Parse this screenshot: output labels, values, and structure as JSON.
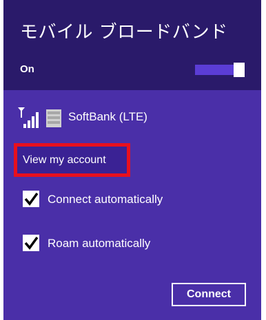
{
  "header": {
    "title": "モバイル ブロードバンド",
    "state_label": "On"
  },
  "toggle": {
    "on": true
  },
  "network": {
    "name": "SoftBank (LTE)",
    "signal_icon": "signal-strength-icon",
    "sim_icon": "sim-card-icon"
  },
  "account": {
    "link_label": "View my account"
  },
  "options": {
    "connect_auto_label": "Connect automatically",
    "connect_auto_checked": true,
    "roam_auto_label": "Roam automatically",
    "roam_auto_checked": true
  },
  "actions": {
    "connect_label": "Connect"
  },
  "colors": {
    "panel": "#4a2fa8",
    "header": "#2a1a6a",
    "highlight": "#e8101e",
    "text": "#ffffff"
  }
}
